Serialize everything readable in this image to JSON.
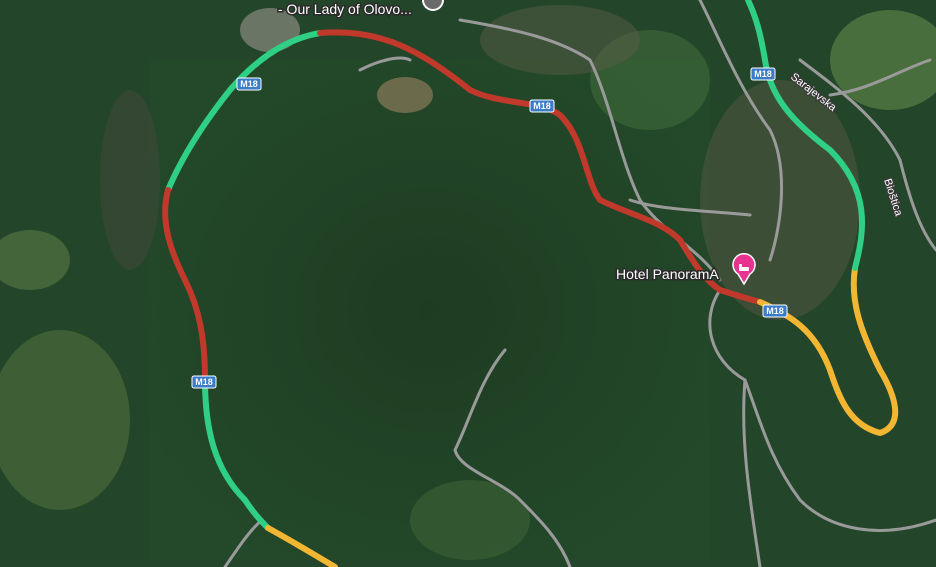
{
  "map": {
    "type": "satellite",
    "traffic_colors": {
      "heavy": "#c0392b",
      "moderate": "#f2b632",
      "free": "#2fcf86"
    }
  },
  "places": {
    "church": {
      "name": "- Our Lady of Olovo...",
      "icon": "place-pin-icon"
    },
    "hotel": {
      "name": "Hotel PanoramA",
      "icon": "hotel-bed-icon",
      "color": "#e6338f"
    }
  },
  "roads": {
    "route_shield": "M18",
    "street_sarajevska": "Sarajevska",
    "street_biostica": "Bioštica"
  }
}
